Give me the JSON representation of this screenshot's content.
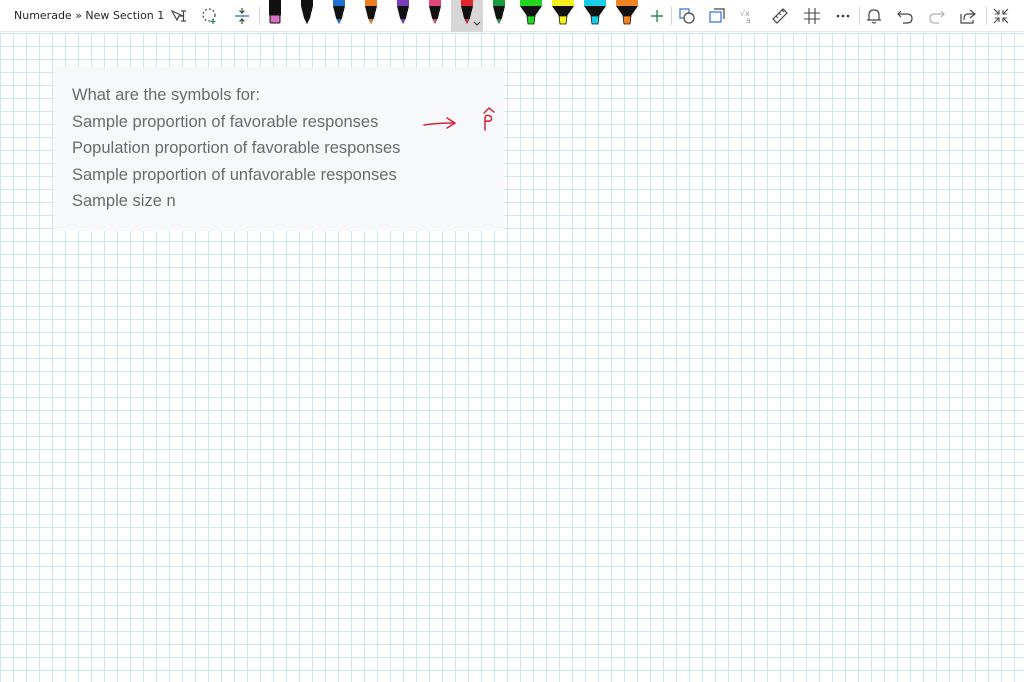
{
  "toolbar": {
    "breadcrumb": "Numerade » New Section 1",
    "icons": [
      "ink-to-text-icon",
      "lasso-select-icon",
      "insert-space-icon"
    ],
    "pen_colors": [
      "#d86fc7",
      "#111111",
      "#1f6fd1",
      "#ef7d22",
      "#7a3fb8",
      "#e0457b",
      "#e3262b",
      "#1a9a3a",
      "#22d61f",
      "#f7f01a",
      "#19cde8",
      "#f28322"
    ],
    "selected_pen_index": 6,
    "right_icons": [
      "add-pen-icon",
      "shapes-icon",
      "ink-to-shape-icon",
      "ink-to-math-icon",
      "ruler-icon",
      "grid-icon",
      "more-icon",
      "notification-icon",
      "undo-icon",
      "redo-icon",
      "share-icon",
      "fullscreen-icon"
    ]
  },
  "note": {
    "lines": [
      "What are the symbols for:",
      "Sample proportion of favorable responses",
      "Population proportion of favorable responses",
      "Sample proportion of unfavorable responses",
      "Sample size n"
    ]
  },
  "ink": {
    "color": "#d1263b",
    "annotation": "arrow-to-p-hat"
  }
}
